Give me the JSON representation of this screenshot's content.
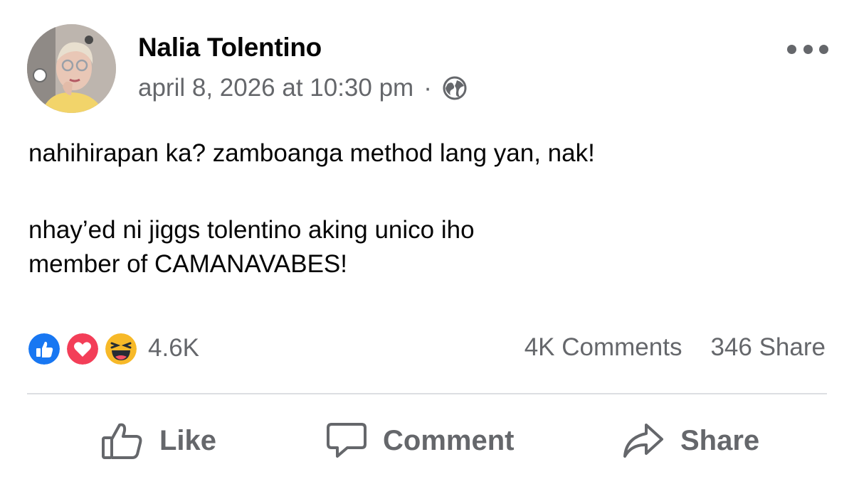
{
  "post": {
    "author": "Nalia Tolentino",
    "timestamp": "april 8, 2026 at 10:30 pm",
    "separator": "·",
    "audience_icon": "globe-icon",
    "lines": [
      "nahihirapan ka? zamboanga method lang yan, nak!",
      "nhay’ed ni jiggs tolentino aking unico iho",
      "member of CAMANAVABES!"
    ]
  },
  "stats": {
    "reaction_icons": [
      "like-icon",
      "love-icon",
      "haha-icon"
    ],
    "reaction_count": "4.6K",
    "comments": "4K Comments",
    "shares": "346 Share"
  },
  "actions": {
    "like_label": "Like",
    "comment_label": "Comment",
    "share_label": "Share"
  },
  "colors": {
    "like_blue": "#1877f2",
    "love_red": "#f33e58",
    "haha_yellow": "#f7b928",
    "secondary_text": "#65676b"
  }
}
